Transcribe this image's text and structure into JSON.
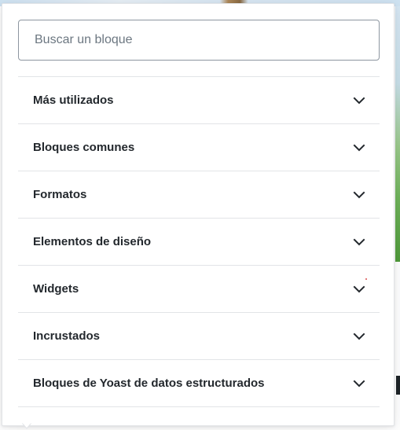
{
  "search": {
    "placeholder": "Buscar un bloque",
    "value": ""
  },
  "panels": [
    {
      "label": "Más utilizados",
      "icon": "chevron-down-icon"
    },
    {
      "label": "Bloques comunes",
      "icon": "chevron-down-icon"
    },
    {
      "label": "Formatos",
      "icon": "chevron-down-icon"
    },
    {
      "label": "Elementos de diseño",
      "icon": "chevron-down-icon"
    },
    {
      "label": "Widgets",
      "icon": "chevron-down-icon"
    },
    {
      "label": "Incrustados",
      "icon": "chevron-down-icon"
    },
    {
      "label": "Bloques de Yoast de datos estructurados",
      "icon": "chevron-down-icon"
    }
  ],
  "colors": {
    "text": "#23282d",
    "border": "#e2e4e7",
    "input_border": "#8d96a0",
    "placeholder": "#6c7781"
  }
}
